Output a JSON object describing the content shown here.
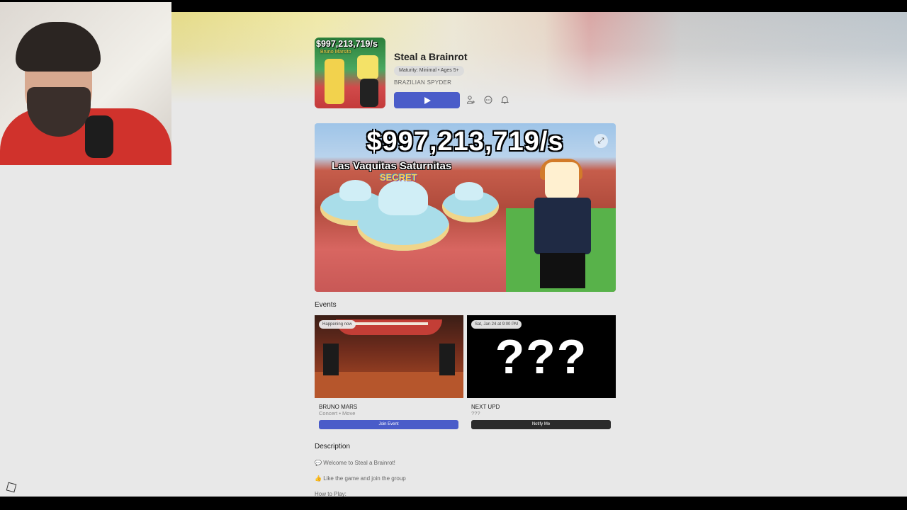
{
  "game": {
    "title": "Steal a Brainrot",
    "maturity": "Maturity: Minimal • Ages 5+",
    "creator": "BRAZILIAN SPYDER",
    "thumbnail_money": "$997,213,719/s",
    "thumbnail_sub": "Bruno Marsito"
  },
  "actions": {
    "play_icon": "play-icon",
    "icons": [
      "user-add-icon",
      "more-icon",
      "bell-icon"
    ]
  },
  "media": {
    "money": "$997,213,719/s",
    "name": "Las Vaquitas Saturnitas",
    "tag": "SECRET",
    "dot_count": 5,
    "active_dot": 4
  },
  "events": {
    "heading": "Events",
    "items": [
      {
        "badge": "Happening now",
        "title": "BRUNO MARS",
        "subtitle": "Concert • Move",
        "button": "Join Event",
        "button_color": "#4a5cc9"
      },
      {
        "badge": "Sat, Jan 24 at 9:00 PM",
        "title": "NEXT UPD",
        "subtitle": "???",
        "image_text": "???",
        "button": "Notify Me",
        "button_color": "#2b2b2b"
      }
    ]
  },
  "description": {
    "heading": "Description",
    "lines": [
      "Welcome to Steal a Brainrot!",
      "Like the game and join the group",
      "How to Play:"
    ]
  },
  "colors": {
    "accent": "#4a5cc9",
    "background": "#e8e8e8"
  }
}
